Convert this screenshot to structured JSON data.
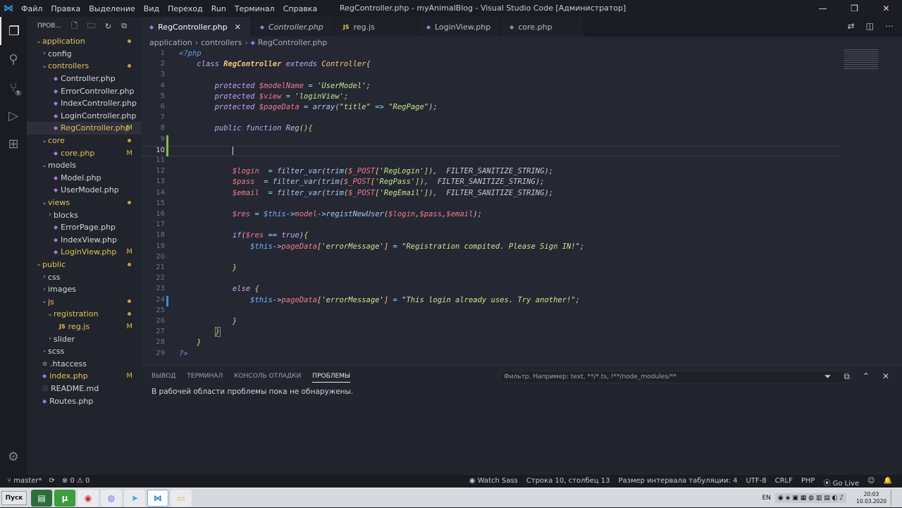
{
  "window": {
    "title": "RegController.php - myAnimalBlog - Visual Studio Code [Администратор]",
    "menu": [
      "Файл",
      "Правка",
      "Выделение",
      "Вид",
      "Переход",
      "Run",
      "Терминал",
      "Справка"
    ]
  },
  "sidebar": {
    "header": "ПРОВ...",
    "tree": [
      {
        "label": "application",
        "indent": 0,
        "chev": "⌄",
        "type": "folder",
        "status": "dot",
        "modified": true
      },
      {
        "label": "config",
        "indent": 1,
        "chev": "›",
        "type": "folder",
        "status": ""
      },
      {
        "label": "controllers",
        "indent": 1,
        "chev": "⌄",
        "type": "folder",
        "status": "dot",
        "modified": true
      },
      {
        "label": "Controller.php",
        "indent": 2,
        "chev": "",
        "type": "php",
        "status": ""
      },
      {
        "label": "ErrorController.php",
        "indent": 2,
        "chev": "",
        "type": "php",
        "status": ""
      },
      {
        "label": "IndexController.php",
        "indent": 2,
        "chev": "",
        "type": "php",
        "status": ""
      },
      {
        "label": "LoginController.php",
        "indent": 2,
        "chev": "",
        "type": "php",
        "status": ""
      },
      {
        "label": "RegController.php",
        "indent": 2,
        "chev": "",
        "type": "php",
        "status": "M",
        "modified": true,
        "selected": true
      },
      {
        "label": "core",
        "indent": 1,
        "chev": "⌄",
        "type": "folder",
        "status": "dot",
        "modified": true
      },
      {
        "label": "core.php",
        "indent": 2,
        "chev": "",
        "type": "php",
        "status": "M",
        "modified": true
      },
      {
        "label": "models",
        "indent": 1,
        "chev": "⌄",
        "type": "folder",
        "status": ""
      },
      {
        "label": "Model.php",
        "indent": 2,
        "chev": "",
        "type": "php",
        "status": ""
      },
      {
        "label": "UserModel.php",
        "indent": 2,
        "chev": "",
        "type": "php",
        "status": ""
      },
      {
        "label": "views",
        "indent": 1,
        "chev": "⌄",
        "type": "folder",
        "status": "dot",
        "modified": true
      },
      {
        "label": "blocks",
        "indent": 2,
        "chev": "›",
        "type": "folder",
        "status": ""
      },
      {
        "label": "ErrorPage.php",
        "indent": 2,
        "chev": "",
        "type": "php",
        "status": ""
      },
      {
        "label": "IndexView.php",
        "indent": 2,
        "chev": "",
        "type": "php",
        "status": ""
      },
      {
        "label": "LoginView.php",
        "indent": 2,
        "chev": "",
        "type": "php",
        "status": "M",
        "modified": true
      },
      {
        "label": "public",
        "indent": 0,
        "chev": "⌄",
        "type": "folder",
        "status": "dot",
        "modified": true
      },
      {
        "label": "css",
        "indent": 1,
        "chev": "›",
        "type": "folder",
        "status": ""
      },
      {
        "label": "images",
        "indent": 1,
        "chev": "›",
        "type": "folder",
        "status": ""
      },
      {
        "label": "js",
        "indent": 1,
        "chev": "⌄",
        "type": "folder",
        "status": "dot",
        "modified": true
      },
      {
        "label": "registration",
        "indent": 2,
        "chev": "⌄",
        "type": "folder",
        "status": "dot",
        "modified": true
      },
      {
        "label": "reg.js",
        "indent": 3,
        "chev": "",
        "type": "js",
        "status": "M",
        "modified": true
      },
      {
        "label": "slider",
        "indent": 2,
        "chev": "›",
        "type": "folder",
        "status": ""
      },
      {
        "label": "scss",
        "indent": 1,
        "chev": "›",
        "type": "folder",
        "status": ""
      },
      {
        "label": ".htaccess",
        "indent": 0,
        "chev": "",
        "type": "gear",
        "status": ""
      },
      {
        "label": "index.php",
        "indent": 0,
        "chev": "",
        "type": "php",
        "status": "M",
        "modified": true
      },
      {
        "label": "README.md",
        "indent": 0,
        "chev": "",
        "type": "info",
        "status": ""
      },
      {
        "label": "Routes.php",
        "indent": 0,
        "chev": "",
        "type": "php",
        "status": ""
      }
    ]
  },
  "tabs": [
    {
      "label": "RegController.php",
      "icon": "php",
      "active": true,
      "italic": false
    },
    {
      "label": "Controller.php",
      "icon": "php",
      "active": false,
      "italic": true
    },
    {
      "label": "reg.js",
      "icon": "js",
      "active": false,
      "italic": false
    },
    {
      "label": "LoginView.php",
      "icon": "php",
      "active": false,
      "italic": false
    },
    {
      "label": "core.php",
      "icon": "php",
      "active": false,
      "italic": false
    }
  ],
  "breadcrumb": [
    "application",
    "controllers",
    "RegController.php"
  ],
  "editor": {
    "current_line": 10,
    "lines": [
      {
        "n": 1,
        "html": "<span class='tag'>&lt;?php</span>"
      },
      {
        "n": 2,
        "html": "    <span class='kw'>class</span> <span class='cls'>RegController</span> <span class='kw'>extends</span> <span class='cls2'>Controller</span><span class='brk'>{</span>"
      },
      {
        "n": 3,
        "html": ""
      },
      {
        "n": 4,
        "html": "        <span class='kw'>protected</span> <span class='var'>$modelName</span> <span class='op'>=</span> <span class='str'>'UserModel'</span>;"
      },
      {
        "n": 5,
        "html": "        <span class='kw'>protected</span> <span class='var'>$view</span> <span class='op'>=</span> <span class='str'>'loginView'</span>;"
      },
      {
        "n": 6,
        "html": "        <span class='kw'>protected</span> <span class='var'>$pageData</span> <span class='op'>=</span> <span class='fn'>array</span>(<span class='str'>\"title\"</span> <span class='op'>=&gt;</span> <span class='str'>\"RegPage\"</span>);"
      },
      {
        "n": 7,
        "html": ""
      },
      {
        "n": 8,
        "html": "        <span class='kw'>public</span> <span class='kw'>function</span> <span class='fn'>Reg</span><span class='brk'>()</span><span class='brk'>{</span>"
      },
      {
        "n": 9,
        "html": ""
      },
      {
        "n": 10,
        "html": "            <span style='border-left:1px solid #e0e0e0'>&nbsp;</span>"
      },
      {
        "n": 11,
        "html": ""
      },
      {
        "n": 12,
        "html": "            <span class='var'>$login</span>  <span class='op'>=</span> <span class='fn'>filter_var</span>(<span class='fn'>trim</span>(<span class='var'>$_POST</span><span class='brk'>[</span><span class='str'>'RegLogin'</span><span class='brk'>]</span>),  FILTER_SANITIZE_STRING);"
      },
      {
        "n": 13,
        "html": "            <span class='var'>$pass</span>  <span class='op'>=</span> <span class='fn'>filter_var</span>(<span class='fn'>trim</span>(<span class='var'>$_POST</span><span class='brk'>[</span><span class='str'>'RegPass'</span><span class='brk'>]</span>),  FILTER_SANITIZE_STRING);"
      },
      {
        "n": 14,
        "html": "            <span class='var'>$email</span>  <span class='op'>=</span> <span class='fn'>filter_var</span>(<span class='fn'>trim</span>(<span class='var'>$_POST</span><span class='brk'>[</span><span class='str'>'RegEmail'</span><span class='brk'>]</span>),  FILTER_SANITIZE_STRING);"
      },
      {
        "n": 15,
        "html": ""
      },
      {
        "n": 16,
        "html": "            <span class='var'>$res</span> <span class='op'>=</span> <span class='thisv'>$this</span><span class='op'>-&gt;</span><span class='prop'>model</span><span class='op'>-&gt;</span><span class='fn'>registNewUser</span>(<span class='var'>$login</span>,<span class='var'>$pass</span>,<span class='var'>$email</span>);"
      },
      {
        "n": 17,
        "html": ""
      },
      {
        "n": 18,
        "html": "            <span class='kw'>if</span>(<span class='var'>$res</span> <span class='op'>==</span> <span class='kw'>true</span>)<span class='brk'>{</span>"
      },
      {
        "n": 19,
        "html": "                <span class='thisv'>$this</span><span class='op'>-&gt;</span><span class='prop'>pageData</span><span class='brk'>[</span><span class='str'>'errorMessage'</span><span class='brk'>]</span> <span class='op'>=</span> <span class='str'>\"Registration compited. Please Sign IN!\"</span>;"
      },
      {
        "n": 20,
        "html": ""
      },
      {
        "n": 21,
        "html": "            <span class='brk'>}</span>"
      },
      {
        "n": 22,
        "html": ""
      },
      {
        "n": 23,
        "html": "            <span class='kw'>else</span> <span class='brk'>{</span>"
      },
      {
        "n": 24,
        "html": "                <span class='thisv'>$this</span><span class='op'>-&gt;</span><span class='prop'>pageData</span><span class='brk'>[</span><span class='str'>'errorMessage'</span><span class='brk'>]</span> <span class='op'>=</span> <span class='str'>\"This login already uses. Try another!\"</span>;"
      },
      {
        "n": 25,
        "html": ""
      },
      {
        "n": 26,
        "html": "            <span class='brk'>}</span>"
      },
      {
        "n": 27,
        "html": "        <span class='brk' style='border:1px solid #888'>}</span>"
      },
      {
        "n": 28,
        "html": "    <span class='brk'>}</span>"
      },
      {
        "n": 29,
        "html": "<span class='tag'>?&gt;</span>"
      }
    ]
  },
  "panel": {
    "tabs": [
      "ВЫВОД",
      "ТЕРМИНАЛ",
      "КОНСОЛЬ ОТЛАДКИ",
      "ПРОБЛЕМЫ"
    ],
    "active_tab": "ПРОБЛЕМЫ",
    "filter_placeholder": "Фильтр. Например: text, **/*.ts, !**/node_modules/**",
    "message": "В рабочей области проблемы пока не обнаружены."
  },
  "statusbar": {
    "branch": "master*",
    "problems": "⊗ 0 ⚠ 0",
    "watch_sass": "Watch Sass",
    "position": "Строка 10, столбец 13",
    "indent": "Размер интервала табуляции: 4",
    "encoding": "UTF-8",
    "eol": "CRLF",
    "language": "PHP",
    "golive": "Go Live"
  },
  "taskbar": {
    "start": "Пуск",
    "lang": "EN",
    "time": "20:03",
    "date": "10.03.2020"
  },
  "colors": {
    "accent": "#2f9bf0",
    "modified": "#e2c25a"
  }
}
